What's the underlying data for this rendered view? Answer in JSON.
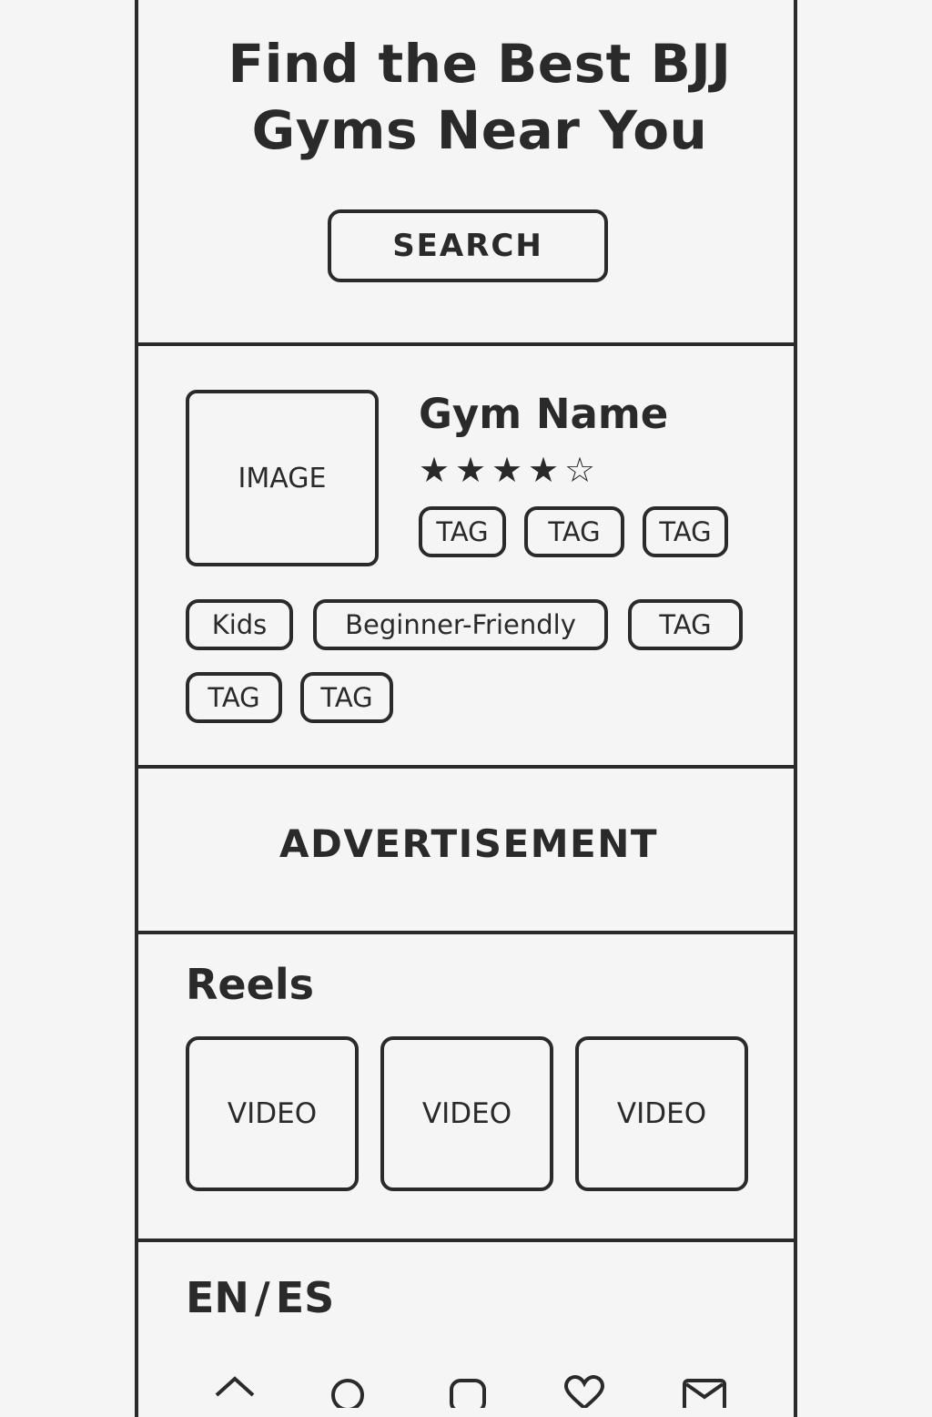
{
  "hero": {
    "title_line1": "Find the Best BJJ",
    "title_line2": "Gyms Near You",
    "search_label": "SEARCH"
  },
  "gym_card": {
    "image_label": "IMAGE",
    "name": "Gym Name",
    "rating": 4,
    "rating_max": 5,
    "stars": [
      "★",
      "★",
      "★",
      "★",
      "☆"
    ],
    "top_tags": [
      "TAG",
      "TAG",
      "TAG"
    ],
    "tags": [
      "Kids",
      "Beginner-Friendly",
      "TAG",
      "TAG",
      "TAG"
    ]
  },
  "advertisement": {
    "label": "ADVERTISEMENT"
  },
  "reels": {
    "heading": "Reels",
    "videos": [
      "VIDEO",
      "VIDEO",
      "VIDEO"
    ]
  },
  "language": {
    "en": "EN",
    "separator": "/",
    "es": "ES"
  },
  "bottom_nav": {
    "icons": [
      "home-icon",
      "search-icon",
      "chat-icon",
      "heart-icon",
      "mail-icon"
    ]
  },
  "colors": {
    "ink": "#2a2a2a",
    "background": "#f5f5f5"
  }
}
